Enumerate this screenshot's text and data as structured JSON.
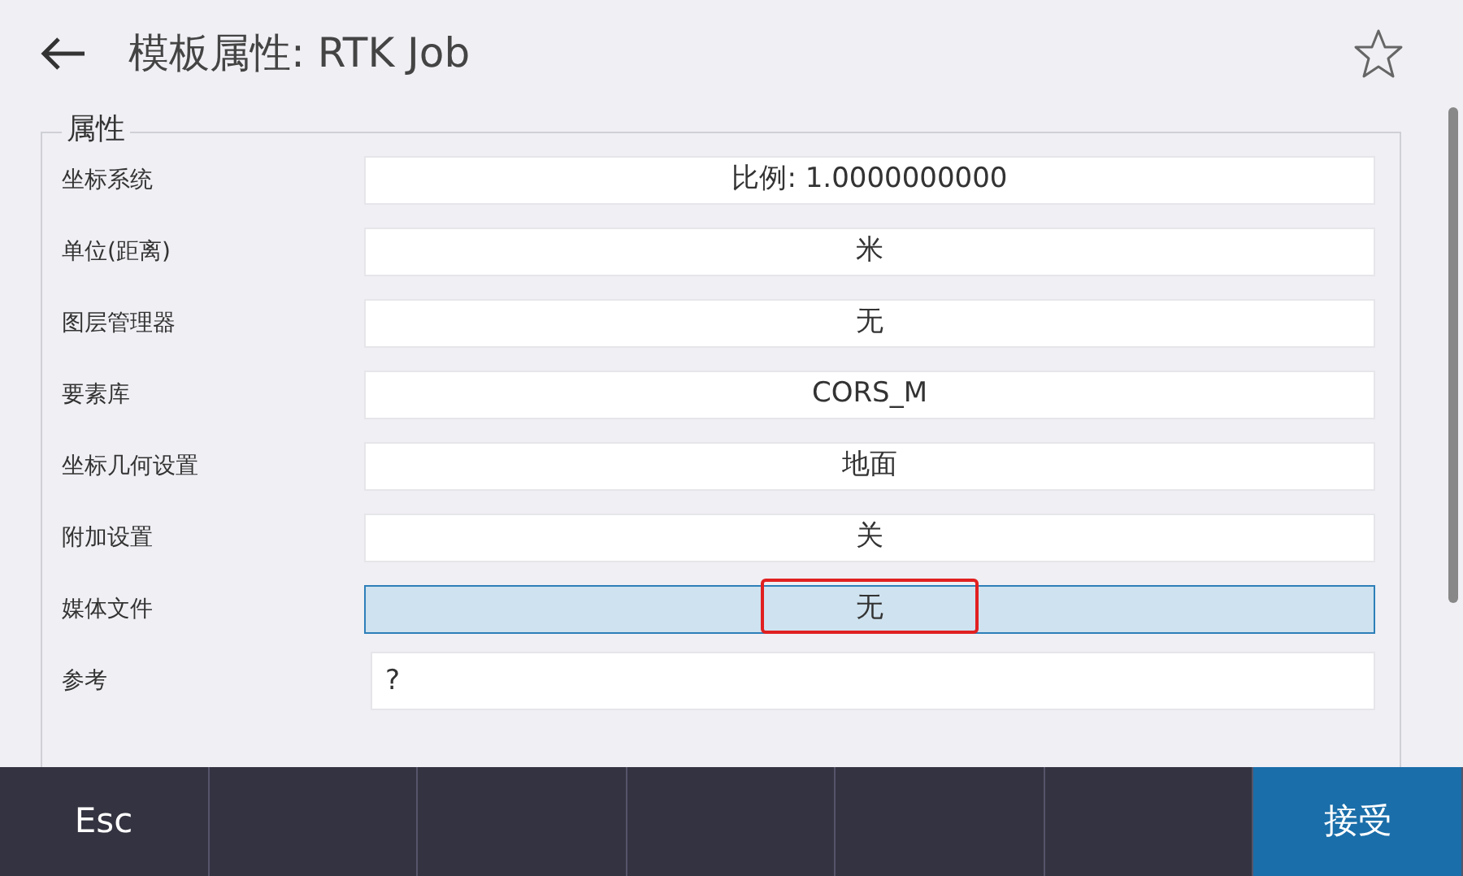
{
  "header": {
    "title": "模板属性:  RTK Job",
    "favorite": false
  },
  "group": {
    "title": "属性",
    "rows": [
      {
        "label": "坐标系统",
        "value": "比例:  1.0000000000",
        "kind": "select",
        "selected": false,
        "annotated": false
      },
      {
        "label": "单位(距离)",
        "value": "米",
        "kind": "select",
        "selected": false,
        "annotated": false
      },
      {
        "label": "图层管理器",
        "value": "无",
        "kind": "select",
        "selected": false,
        "annotated": false
      },
      {
        "label": "要素库",
        "value": "CORS_M",
        "kind": "select",
        "selected": false,
        "annotated": false
      },
      {
        "label": "坐标几何设置",
        "value": "地面",
        "kind": "select",
        "selected": false,
        "annotated": false
      },
      {
        "label": "附加设置",
        "value": "关",
        "kind": "select",
        "selected": false,
        "annotated": false
      },
      {
        "label": "媒体文件",
        "value": "无",
        "kind": "select",
        "selected": true,
        "annotated": true
      },
      {
        "label": "参考",
        "value": "?",
        "kind": "text",
        "selected": false,
        "annotated": false
      }
    ]
  },
  "softkeys": [
    {
      "label": "Esc",
      "kind": "normal"
    },
    {
      "kind": "empty"
    },
    {
      "kind": "empty"
    },
    {
      "kind": "empty"
    },
    {
      "kind": "empty"
    },
    {
      "kind": "empty"
    },
    {
      "label": "接受",
      "kind": "primary"
    }
  ]
}
